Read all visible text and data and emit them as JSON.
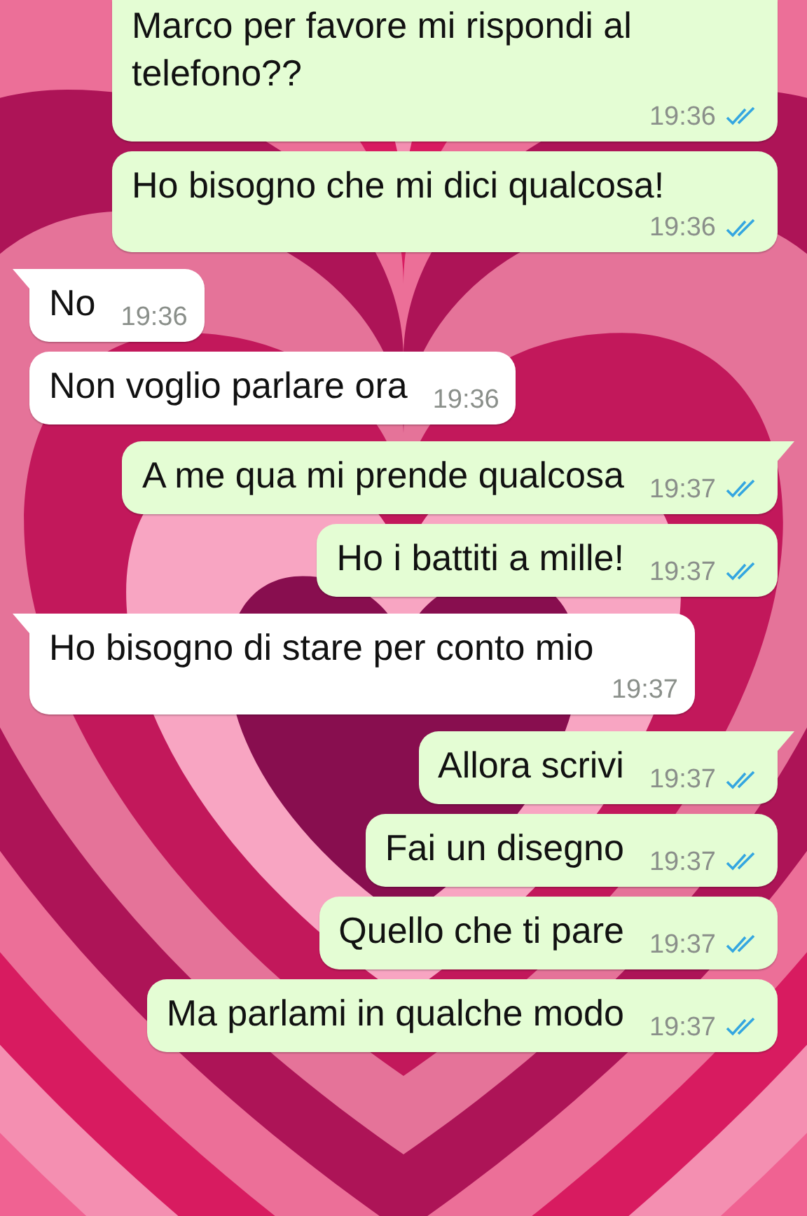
{
  "messages": [
    {
      "outgoing": true,
      "text": "Marco per favore mi rispondi al telefono??",
      "time": "19:36",
      "read": true,
      "tail": false
    },
    {
      "outgoing": true,
      "text": "Ho bisogno che mi dici qualcosa!",
      "time": "19:36",
      "read": true,
      "tail": false
    },
    {
      "outgoing": false,
      "text": "No",
      "time": "19:36",
      "tail": true
    },
    {
      "outgoing": false,
      "text": "Non voglio parlare ora",
      "time": "19:36",
      "tail": false
    },
    {
      "outgoing": true,
      "text": "A me qua mi prende qualcosa",
      "time": "19:37",
      "read": true,
      "tail": true
    },
    {
      "outgoing": true,
      "text": "Ho i battiti a mille!",
      "time": "19:37",
      "read": true,
      "tail": false
    },
    {
      "outgoing": false,
      "text": "Ho bisogno di stare per conto mio",
      "time": "19:37",
      "tail": true
    },
    {
      "outgoing": true,
      "text": "Allora scrivi",
      "time": "19:37",
      "read": true,
      "tail": true
    },
    {
      "outgoing": true,
      "text": "Fai un disegno",
      "time": "19:37",
      "read": true,
      "tail": false
    },
    {
      "outgoing": true,
      "text": "Quello che ti pare",
      "time": "19:37",
      "read": true,
      "tail": false
    },
    {
      "outgoing": true,
      "text": "Ma parlami in qualche modo",
      "time": "19:37",
      "read": true,
      "tail": false
    }
  ]
}
